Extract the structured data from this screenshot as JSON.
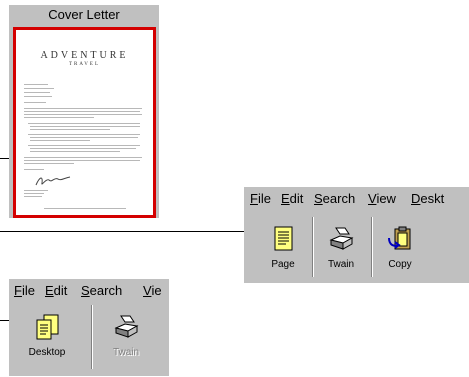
{
  "cover_letter": {
    "title": "Cover Letter",
    "brand_line1": "ADVENTURE",
    "brand_line2": "TRAVEL"
  },
  "toolbar_full": {
    "menus": [
      "File",
      "Edit",
      "Search",
      "View",
      "Deskt"
    ],
    "menu_accel": [
      "F",
      "E",
      "S",
      "V",
      "D"
    ],
    "buttons": [
      {
        "label": "Page",
        "icon": "page-icon",
        "enabled": true
      },
      {
        "label": "Twain",
        "icon": "scanner-icon",
        "enabled": true
      },
      {
        "label": "Copy",
        "icon": "copy-clipboard-icon",
        "enabled": true
      }
    ]
  },
  "toolbar_small": {
    "menus": [
      "File",
      "Edit",
      "Search",
      "Vie"
    ],
    "menu_accel": [
      "F",
      "E",
      "S",
      "V"
    ],
    "buttons": [
      {
        "label": "Desktop",
        "icon": "desktop-documents-icon",
        "enabled": true
      },
      {
        "label": "Twain",
        "icon": "scanner-icon",
        "enabled": false
      }
    ]
  },
  "colors": {
    "panel": "#c0c0c0",
    "cover_border": "#d40000"
  }
}
